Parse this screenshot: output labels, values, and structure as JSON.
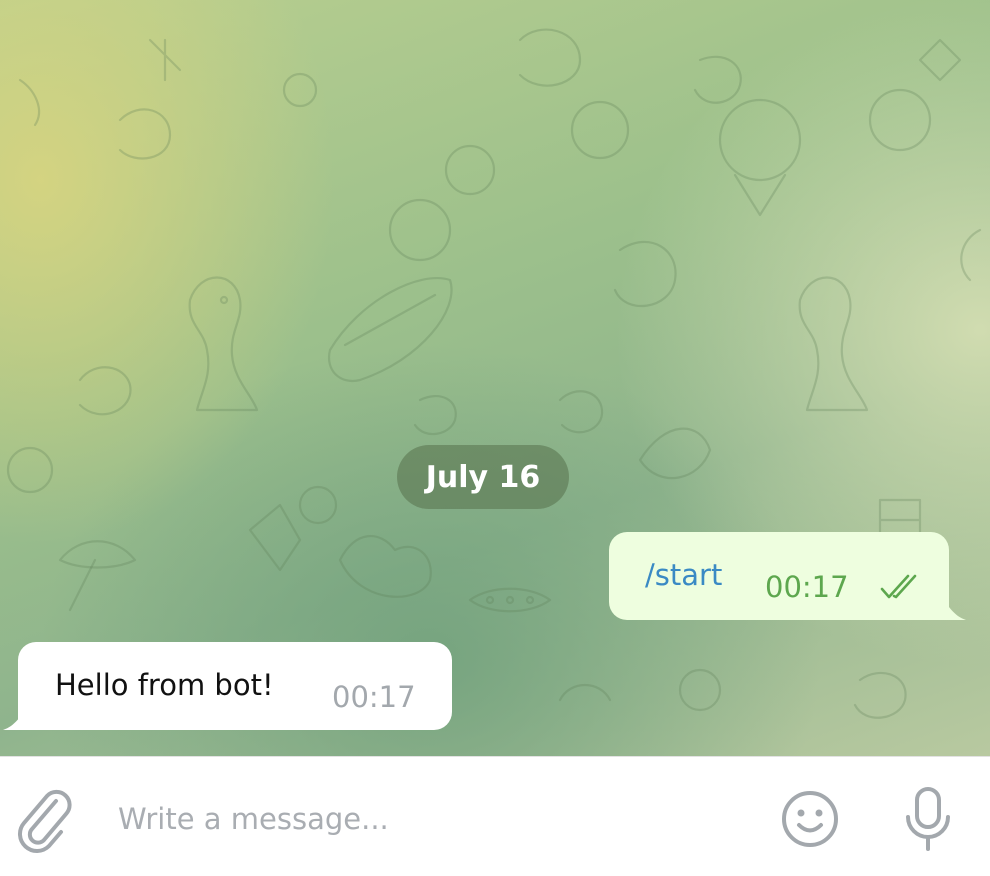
{
  "chat": {
    "date_separator": "July 16",
    "messages": [
      {
        "direction": "outgoing",
        "text": "/start",
        "time": "00:17",
        "status_icon": "double-check-icon",
        "status": "read"
      },
      {
        "direction": "incoming",
        "text": "Hello from bot!",
        "time": "00:17"
      }
    ]
  },
  "composer": {
    "input_value": "",
    "placeholder": "Write a message...",
    "attach_icon": "paperclip-icon",
    "emoji_icon": "smiley-icon",
    "mic_icon": "microphone-icon"
  },
  "colors": {
    "outgoing_bubble": "#eefedf",
    "incoming_bubble": "#ffffff",
    "outgoing_text": "#3a8ac4",
    "outgoing_time": "#5da74e",
    "incoming_time": "#a3a8ad",
    "date_pill": "#5c7852"
  }
}
